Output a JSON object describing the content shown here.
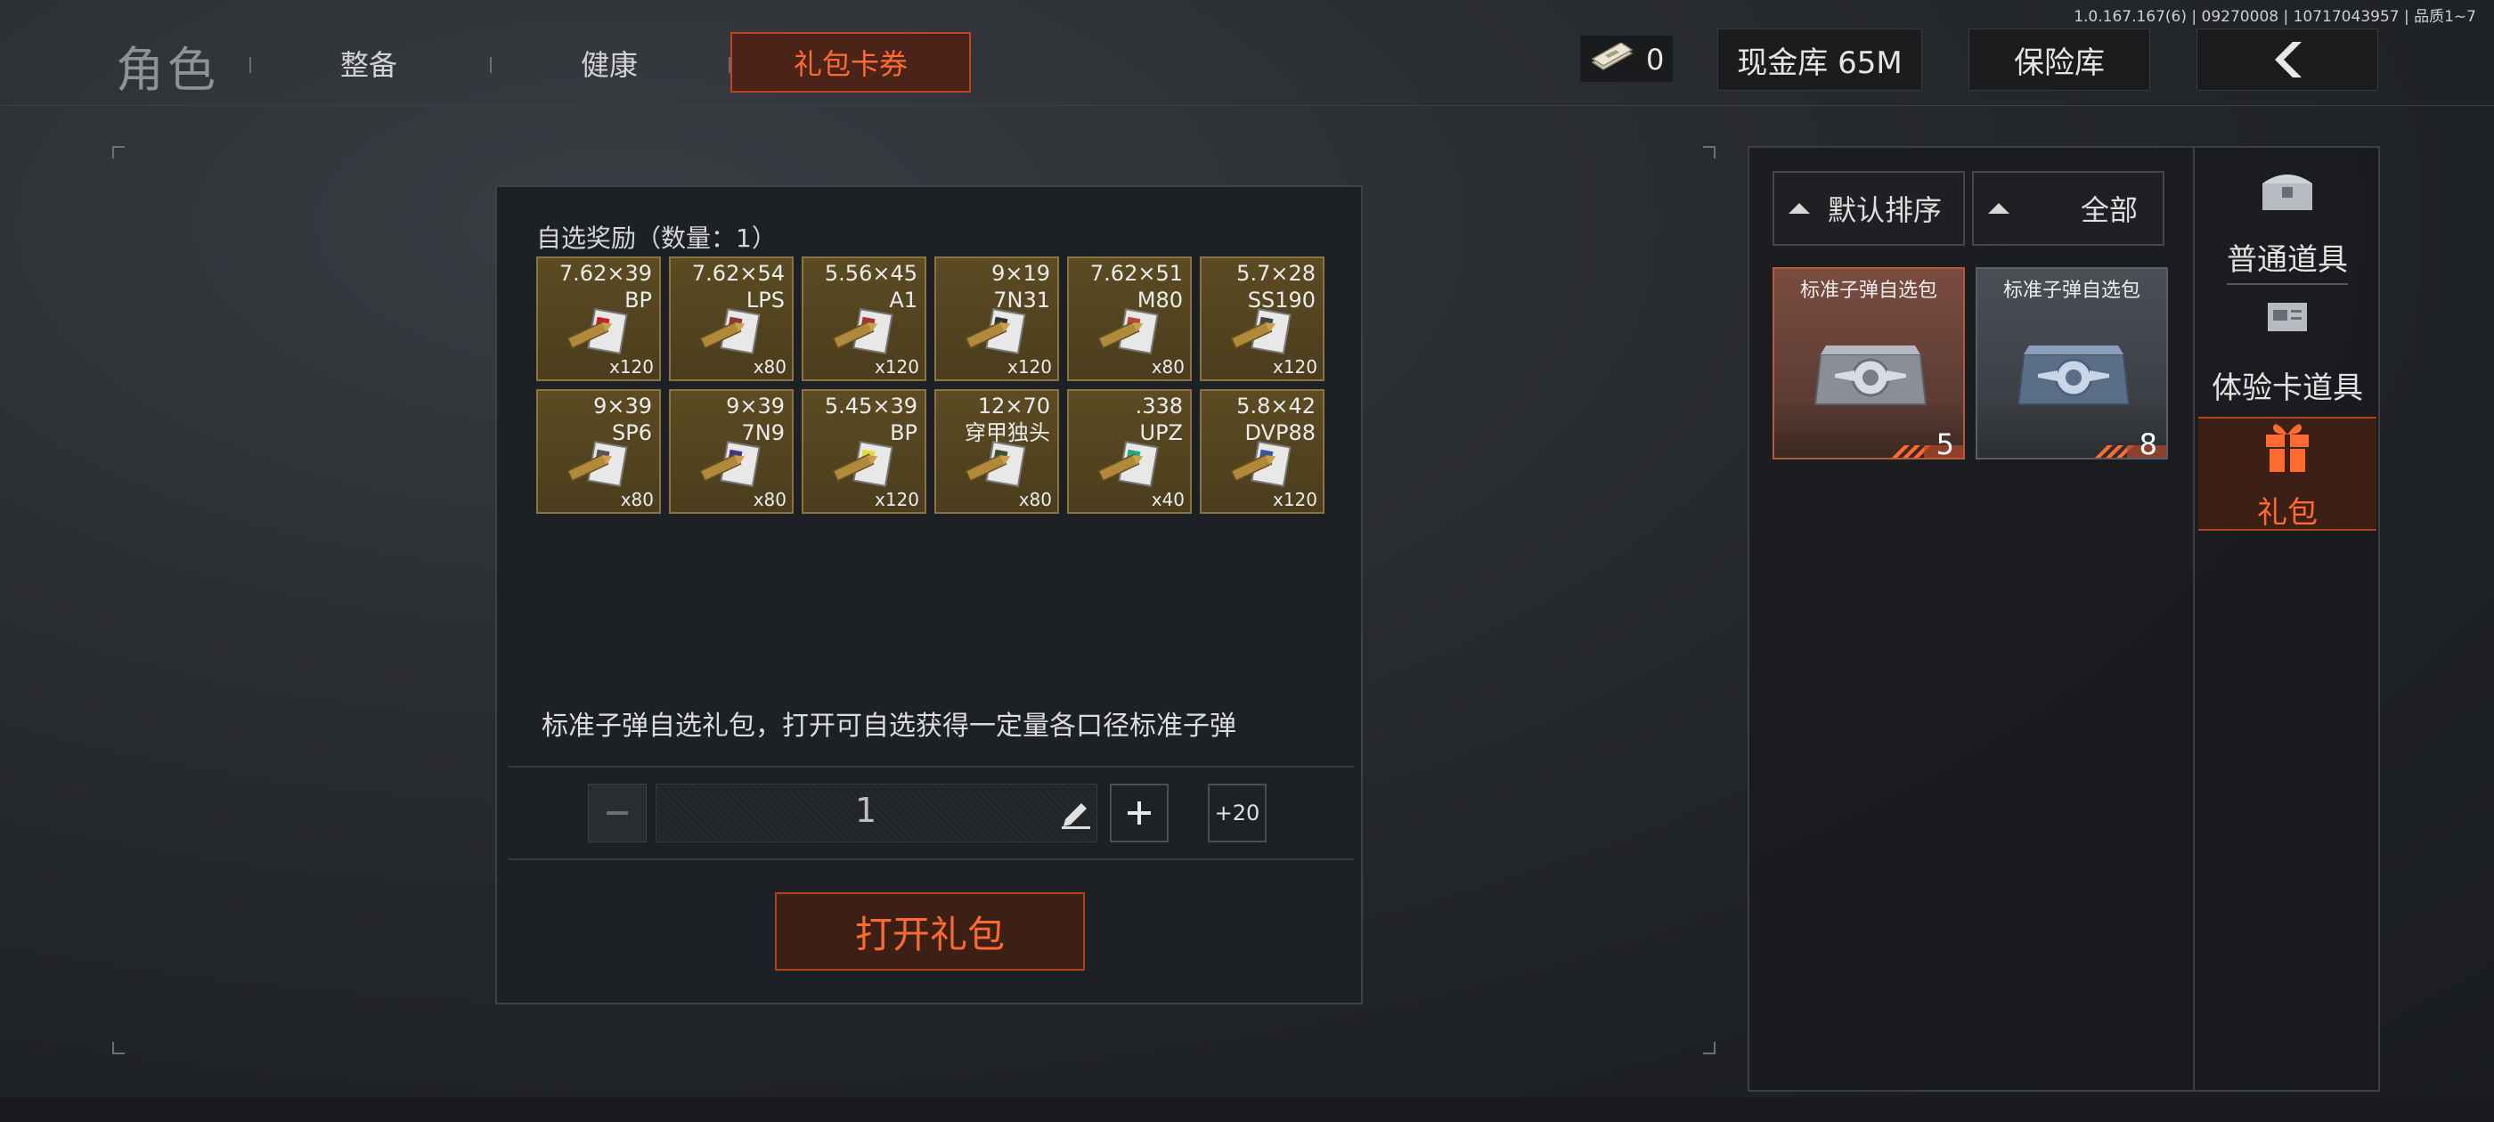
{
  "version": "1.0.167.167(6) | 09270008 | 10717043957 | 品质1~7",
  "nav": {
    "title": "角色",
    "tabs": [
      "整备",
      "健康"
    ],
    "active_tab": "礼包卡券"
  },
  "header": {
    "cash_value": "0",
    "vault_label": "现金库 65M",
    "safe_label": "保险库",
    "back_icon": "back-chevron-icon"
  },
  "reward_panel": {
    "title": "自选奖励（数量：1）",
    "items": [
      {
        "caliber": "7.62×39",
        "code": "BP",
        "qty": "x120"
      },
      {
        "caliber": "7.62×54",
        "code": "LPS",
        "qty": "x80"
      },
      {
        "caliber": "5.56×45",
        "code": "A1",
        "qty": "x120"
      },
      {
        "caliber": "9×19",
        "code": "7N31",
        "qty": "x120"
      },
      {
        "caliber": "7.62×51",
        "code": "M80",
        "qty": "x80"
      },
      {
        "caliber": "5.7×28",
        "code": "SS190",
        "qty": "x120"
      },
      {
        "caliber": "9×39",
        "code": "SP6",
        "qty": "x80"
      },
      {
        "caliber": "9×39",
        "code": "7N9",
        "qty": "x80"
      },
      {
        "caliber": "5.45×39",
        "code": "BP",
        "qty": "x120"
      },
      {
        "caliber": "12×70",
        "code": "穿甲独头",
        "qty": "x80"
      },
      {
        "caliber": ".338",
        "code": "UPZ",
        "qty": "x40"
      },
      {
        "caliber": "5.8×42",
        "code": "DVP88",
        "qty": "x120"
      }
    ],
    "description": "标准子弹自选礼包，打开可自选获得一定量各口径标准子弹",
    "quantity": "1",
    "plus20_label": "+20",
    "open_label": "打开礼包"
  },
  "inventory": {
    "sort_label": "默认排序",
    "filter_label": "全部",
    "cards": [
      {
        "name": "标准子弹自选包",
        "count": "5"
      },
      {
        "name": "标准子弹自选包",
        "count": "8"
      }
    ]
  },
  "categories": [
    {
      "label": "普通道具",
      "icon": "chest-icon"
    },
    {
      "label": "体验卡道具",
      "icon": "card-icon"
    },
    {
      "label": "礼包",
      "icon": "gift-icon"
    }
  ],
  "colors": {
    "accent": "#ff6a2e",
    "accent_border": "#c2431f",
    "item_bg": "#5c4b23"
  }
}
